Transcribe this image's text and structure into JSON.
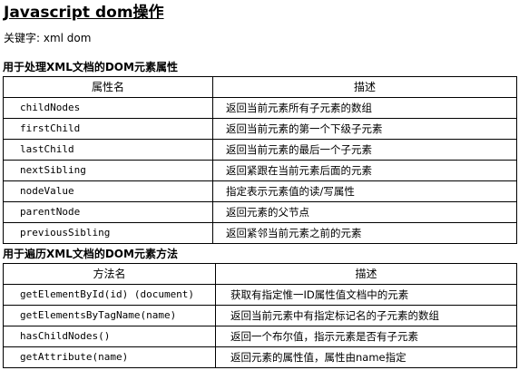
{
  "title": "Javascript dom操作",
  "keywords": "关键字: xml dom",
  "properties_section": {
    "heading": "用于处理XML文档的DOM元素属性",
    "columns": [
      "属性名",
      "描述"
    ],
    "rows": [
      {
        "name": "childNodes",
        "desc": "返回当前元素所有子元素的数组"
      },
      {
        "name": "firstChild",
        "desc": "返回当前元素的第一个下级子元素"
      },
      {
        "name": "lastChild",
        "desc": "返回当前元素的最后一个子元素"
      },
      {
        "name": "nextSibling",
        "desc": "返回紧跟在当前元素后面的元素"
      },
      {
        "name": "nodeValue",
        "desc": "指定表示元素值的读/写属性"
      },
      {
        "name": "parentNode",
        "desc": "返回元素的父节点"
      },
      {
        "name": "previousSibling",
        "desc": "返回紧邻当前元素之前的元素"
      }
    ]
  },
  "methods_section": {
    "heading": "用于遍历XML文档的DOM元素方法",
    "columns": [
      "方法名",
      "描述"
    ],
    "rows": [
      {
        "name": "getElementById(id) (document)",
        "desc": "获取有指定惟一ID属性值文档中的元素"
      },
      {
        "name": "getElementsByTagName(name)",
        "desc": "返回当前元素中有指定标记名的子元素的数组"
      },
      {
        "name": "hasChildNodes()",
        "desc": "返回一个布尔值，指示元素是否有子元素"
      },
      {
        "name": "getAttribute(name)",
        "desc": "返回元素的属性值，属性由name指定"
      }
    ]
  }
}
